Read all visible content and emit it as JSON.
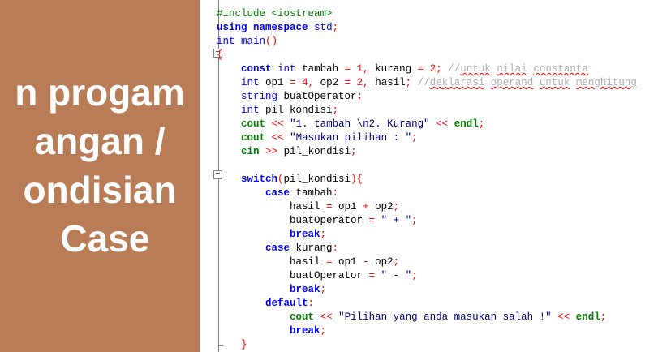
{
  "slide": {
    "title_lines": "n progam\nangan /\nondisian\n Case"
  },
  "editor": {
    "lines": [
      "#include <iostream>",
      "using namespace std;",
      "int main()",
      "{",
      "    const int tambah = 1, kurang = 2; //untuk nilai constanta",
      "    int op1 = 4, op2 = 2, hasil; //deklarasi operand untuk menghitung",
      "    string buatOperator;",
      "    int pil_kondisi;",
      "    cout << \"1. tambah \\n2. Kurang\" << endl;",
      "    cout << \"Masukan pilihan : \";",
      "    cin >> pil_kondisi;",
      "",
      "    switch(pil_kondisi){",
      "        case tambah:",
      "            hasil = op1 + op2;",
      "            buatOperator = \" + \";",
      "            break;",
      "        case kurang:",
      "            hasil = op1 - op2;",
      "            buatOperator = \" - \";",
      "            break;",
      "        default:",
      "            cout << \"Pilihan yang anda masukan salah !\" << endl;",
      "            break;",
      "    }"
    ]
  },
  "colors": {
    "slide_background": "#b87c56",
    "preprocessor": "#008000",
    "keyword": "#0000ff",
    "number": "#ff0000",
    "comment": "#b0b0b0"
  }
}
